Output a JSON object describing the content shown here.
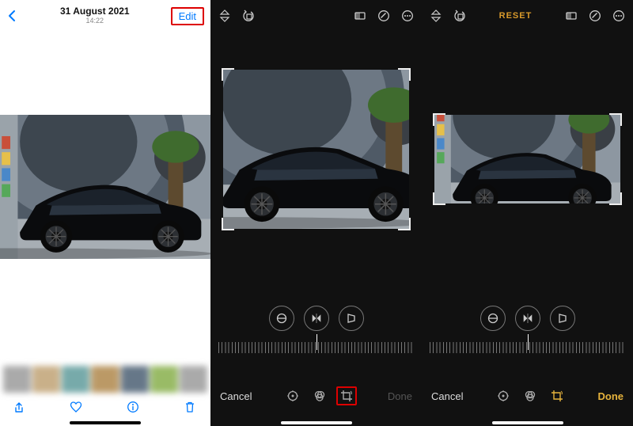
{
  "screen1": {
    "date": "31 August 2021",
    "time": "14:22",
    "edit": "Edit"
  },
  "screen2": {
    "cancel": "Cancel",
    "done": "Done"
  },
  "screen3": {
    "reset": "RESET",
    "cancel": "Cancel",
    "done": "Done"
  },
  "icons": {
    "back": "chevron-left",
    "share": "share",
    "heart": "heart",
    "info": "info-circle",
    "trash": "trash",
    "flipV": "flip-vertical",
    "rotate": "rotate-ccw",
    "aspect": "aspect-ratio",
    "markup": "markup-circle",
    "more": "ellipsis-circle",
    "straighten": "straighten",
    "flipH": "flip-horizontal",
    "perspective": "perspective",
    "adjust": "adjust-dial",
    "filters": "filters-rings",
    "crop": "crop-rotate"
  }
}
